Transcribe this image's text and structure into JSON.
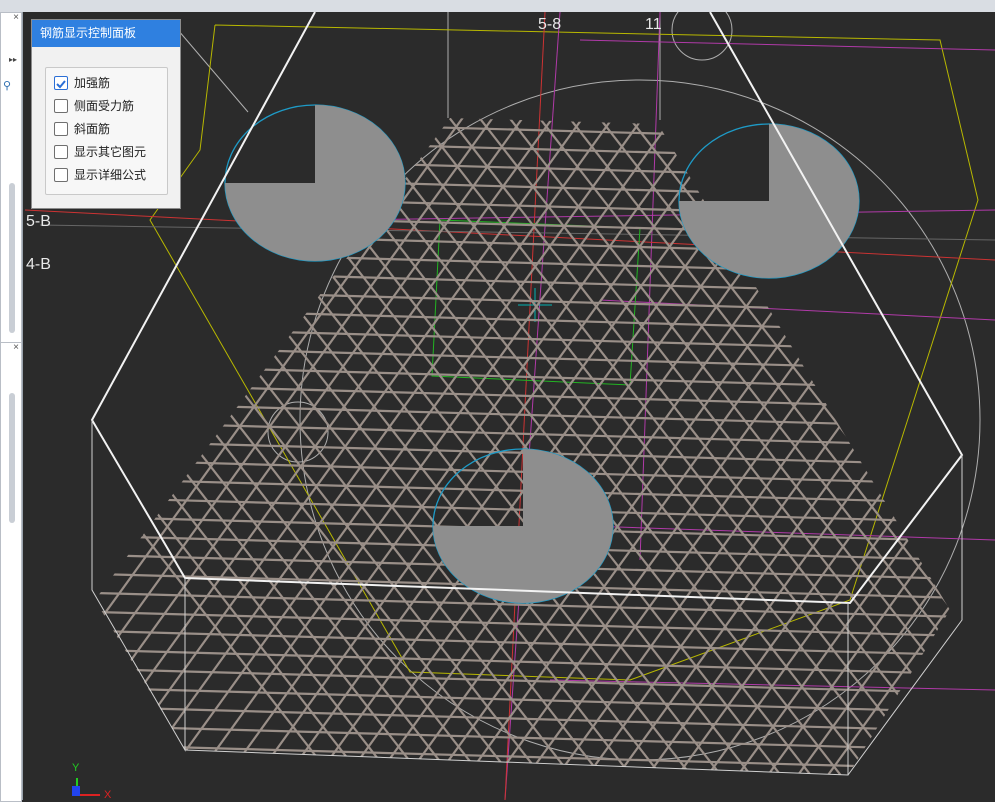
{
  "panel": {
    "title": "钢筋显示控制面板",
    "options": [
      {
        "label": "加强筋",
        "checked": true
      },
      {
        "label": "侧面受力筋",
        "checked": false
      },
      {
        "label": "斜面筋",
        "checked": false
      },
      {
        "label": "显示其它图元",
        "checked": false
      },
      {
        "label": "显示详细公式",
        "checked": false
      }
    ]
  },
  "axis_labels": {
    "top1": "5-8",
    "top2": "11",
    "left1": "5-B",
    "left2": "4-B"
  },
  "triad": {
    "y": "Y",
    "x": "X"
  },
  "left_panels": {
    "close1": "×",
    "close2": "×",
    "more": "▸▸"
  }
}
